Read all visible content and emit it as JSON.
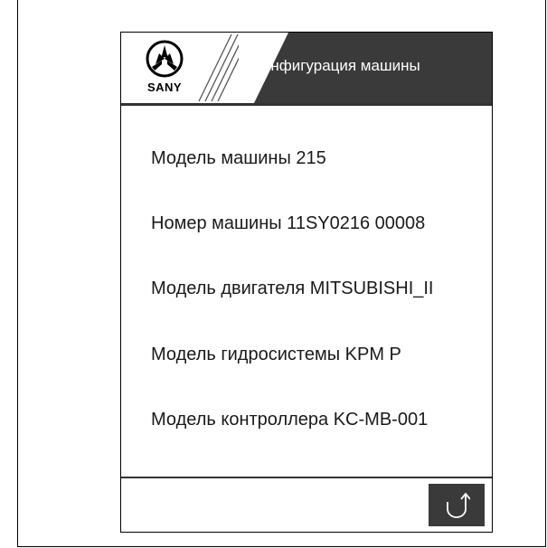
{
  "header": {
    "logo_text": "SANY",
    "title": "Конфигурация машины"
  },
  "info": {
    "machine_model": "Модель машины 215",
    "machine_number": "Номер машины 11SY0216 00008",
    "engine_model": "Модель двигателя MITSUBISHI_II",
    "hydraulic_model": "Модель гидросистемы KPM P",
    "controller_model": "Модель контроллера KC-MB-001"
  },
  "footer": {
    "back_icon": "return-arrow-icon"
  },
  "colors": {
    "title_bar": "#3a3a3a",
    "title_text": "#ffffff",
    "border": "#000000"
  }
}
